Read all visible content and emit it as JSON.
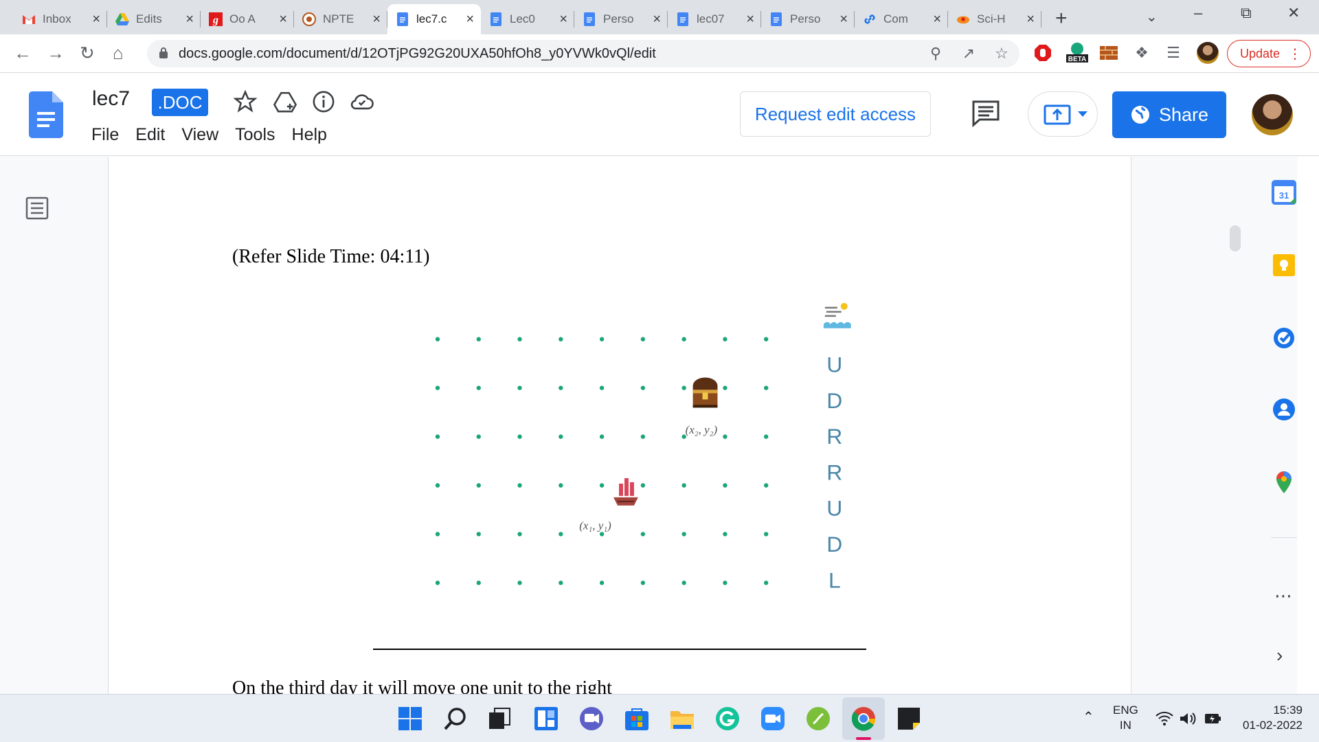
{
  "browser": {
    "tabs": [
      {
        "title": "Inbox",
        "icon": "gmail-icon",
        "active": false
      },
      {
        "title": "Edits",
        "icon": "google-drive-icon",
        "active": false
      },
      {
        "title": "Oo A",
        "icon": "grammarly-g-icon",
        "active": false
      },
      {
        "title": "NPTE",
        "icon": "nptel-icon",
        "active": false
      },
      {
        "title": "lec7.c",
        "icon": "google-docs-icon",
        "active": true
      },
      {
        "title": "Lec0",
        "icon": "google-docs-icon",
        "active": false
      },
      {
        "title": "Perso",
        "icon": "google-docs-icon",
        "active": false
      },
      {
        "title": "lec07",
        "icon": "google-docs-icon",
        "active": false
      },
      {
        "title": "Perso",
        "icon": "google-docs-icon",
        "active": false
      },
      {
        "title": "Com",
        "icon": "link-icon",
        "active": false
      },
      {
        "title": "Sci-H",
        "icon": "sci-hub-icon",
        "active": false
      }
    ],
    "url": "docs.google.com/document/d/12OTjPG92G20UXA50hfOh8_y0YVWk0vQl/edit",
    "update_label": "Update",
    "beta_label": "BETA"
  },
  "docs": {
    "title": "lec7",
    "badge": ".DOC",
    "menu": [
      "File",
      "Edit",
      "View",
      "Tools",
      "Help"
    ],
    "request_edit_label": "Request edit access",
    "share_label": "Share"
  },
  "document": {
    "refer_text": "(Refer Slide Time: 04:11)",
    "body_text": "On the third day it will move one unit to the right",
    "slide": {
      "label_ship": "(x₁, y₁)",
      "label_treasure": "(x₂, y₂)",
      "moves": [
        "U",
        "D",
        "R",
        "R",
        "U",
        "D",
        "L"
      ],
      "grid_cols": 9,
      "grid_rows": 6,
      "dot_color": "#1aa67c",
      "move_color": "#4a86a8"
    }
  },
  "side_panel": {
    "calendar_day": "31"
  },
  "taskbar": {
    "language": "ENG",
    "region": "IN",
    "time": "15:39",
    "date": "01-02-2022"
  }
}
